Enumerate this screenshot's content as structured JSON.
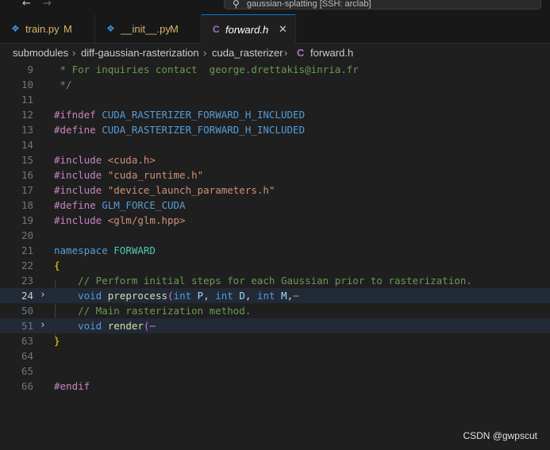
{
  "titlebar": {
    "back_glyph": "←",
    "forward_glyph": "→",
    "search_glyph": "⚲",
    "command_center_text": "gaussian-splatting [SSH: arclab]"
  },
  "tabs": [
    {
      "icon": "python-icon",
      "icon_glyph": "❖",
      "label": "train.py",
      "status": "M"
    },
    {
      "icon": "python-icon",
      "icon_glyph": "❖",
      "label": "__init__.py",
      "status": "M"
    },
    {
      "icon": "c-file-icon",
      "icon_glyph": "C",
      "label": "forward.h",
      "close_glyph": "✕",
      "active": true
    }
  ],
  "breadcrumbs": {
    "items": [
      "submodules",
      "diff-gaussian-rasterization",
      "cuda_rasterizer",
      "forward.h"
    ],
    "separator": "›",
    "file_icon_glyph": "C"
  },
  "editor": {
    "lines": [
      {
        "num": "9",
        "tokens": [
          [
            " * For inquiries contact  george.drettakis@inria.fr",
            "comment"
          ]
        ]
      },
      {
        "num": "10",
        "tokens": [
          [
            " */",
            "comment"
          ]
        ]
      },
      {
        "num": "11",
        "tokens": []
      },
      {
        "num": "12",
        "tokens": [
          [
            "#ifndef ",
            "pre"
          ],
          [
            "CUDA_RASTERIZER_FORWARD_H_INCLUDED",
            "macro"
          ]
        ]
      },
      {
        "num": "13",
        "tokens": [
          [
            "#define ",
            "pre"
          ],
          [
            "CUDA_RASTERIZER_FORWARD_H_INCLUDED",
            "macro"
          ]
        ]
      },
      {
        "num": "14",
        "tokens": []
      },
      {
        "num": "15",
        "tokens": [
          [
            "#include ",
            "pre"
          ],
          [
            "<cuda.h>",
            "str"
          ]
        ]
      },
      {
        "num": "16",
        "tokens": [
          [
            "#include ",
            "pre"
          ],
          [
            "\"cuda_runtime.h\"",
            "str"
          ]
        ]
      },
      {
        "num": "17",
        "tokens": [
          [
            "#include ",
            "pre"
          ],
          [
            "\"device_launch_parameters.h\"",
            "str"
          ]
        ]
      },
      {
        "num": "18",
        "tokens": [
          [
            "#define ",
            "pre"
          ],
          [
            "GLM_FORCE_CUDA",
            "macro"
          ]
        ]
      },
      {
        "num": "19",
        "tokens": [
          [
            "#include ",
            "pre"
          ],
          [
            "<glm/glm.hpp>",
            "str"
          ]
        ]
      },
      {
        "num": "20",
        "tokens": []
      },
      {
        "num": "21",
        "tokens": [
          [
            "namespace ",
            "kw"
          ],
          [
            "FORWARD",
            "ns"
          ]
        ]
      },
      {
        "num": "22",
        "tokens": [
          [
            "{",
            "brace"
          ]
        ]
      },
      {
        "num": "23",
        "tokens": [
          [
            "    // Perform initial steps for each Gaussian prior to rasterization.",
            "comment"
          ]
        ]
      },
      {
        "num": "24",
        "fold": "›",
        "highlight": true,
        "tokens": [
          [
            "    ",
            "plain"
          ],
          [
            "void ",
            "kw"
          ],
          [
            "preprocess",
            "fn"
          ],
          [
            "(",
            "paren"
          ],
          [
            "int ",
            "kw"
          ],
          [
            "P",
            "param"
          ],
          [
            ", ",
            "plain"
          ],
          [
            "int ",
            "kw"
          ],
          [
            "D",
            "param"
          ],
          [
            ", ",
            "plain"
          ],
          [
            "int ",
            "kw"
          ],
          [
            "M",
            "param"
          ],
          [
            ",",
            "plain"
          ],
          [
            "⋯",
            "ell"
          ]
        ]
      },
      {
        "num": "50",
        "tokens": [
          [
            "    // Main rasterization method.",
            "comment"
          ]
        ]
      },
      {
        "num": "51",
        "fold": "›",
        "highlight": true,
        "tokens": [
          [
            "    ",
            "plain"
          ],
          [
            "void ",
            "kw"
          ],
          [
            "render",
            "fn"
          ],
          [
            "(",
            "paren"
          ],
          [
            "⋯",
            "ell"
          ]
        ]
      },
      {
        "num": "63",
        "tokens": [
          [
            "}",
            "brace"
          ]
        ]
      },
      {
        "num": "64",
        "tokens": []
      },
      {
        "num": "65",
        "tokens": []
      },
      {
        "num": "66",
        "tokens": [
          [
            "#endif",
            "pre"
          ]
        ]
      }
    ]
  },
  "watermark": "CSDN @gwpscut",
  "colors": {
    "background": "#1f1f1f",
    "accent": "#0078d4",
    "modified": "#d7b36a"
  }
}
